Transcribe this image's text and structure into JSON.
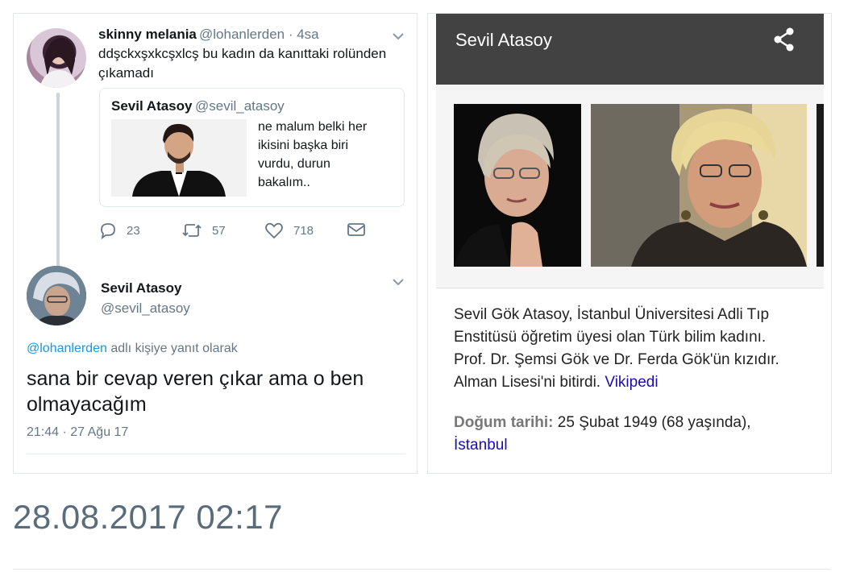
{
  "tweet1": {
    "name": "skinny melania",
    "handle": "@lohanlerden",
    "time": "· 4sa",
    "text_line1": "ddşckxşxkcşxlcş bu kadın da kanıttaki rolünden",
    "text_line2": "çıkamadı"
  },
  "quote": {
    "name": "Sevil Atasoy",
    "handle": "@sevil_atasoy",
    "text_lines": [
      "ne malum belki her",
      "ikisini başka biri",
      "vurdu, durun",
      "bakalım.."
    ]
  },
  "actions": {
    "replies": "23",
    "retweets": "57",
    "likes": "718"
  },
  "tweet2": {
    "name": "Sevil Atasoy",
    "handle": "@sevil_atasoy",
    "reply_to_user": "@lohanlerden",
    "reply_to_suffix": "adlı kişiye yanıt olarak",
    "text_line1": "sana bir cevap veren çıkar ama o ben",
    "text_line2": "olmayacağım",
    "timestamp": "21:44 · 27 Ağu 17"
  },
  "knowledge_card": {
    "title": "Sevil Atasoy",
    "desc_lines": [
      "Sevil Gök Atasoy, İstanbul Üniversitesi Adli Tıp",
      "Enstitüsü öğretim üyesi olan Türk bilim kadını.",
      "Prof. Dr. Şemsi Gök ve Dr. Ferda Gök'ün kızıdır.",
      "Alman Lisesi'ni bitirdi."
    ],
    "source_link": "Vikipedi",
    "born_label": "Doğum tarihi:",
    "born_value": "25 Şubat 1949 (68 yaşında),",
    "born_place": "İstanbul"
  },
  "capture_time": "28.08.2017 02:17",
  "colors": {
    "link_blue": "#1b95e0",
    "google_link": "#1a0dab",
    "header_dark": "#424242"
  }
}
